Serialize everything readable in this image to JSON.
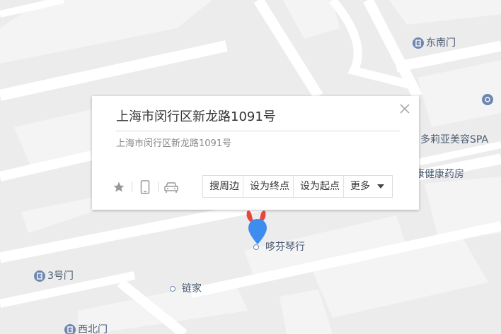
{
  "popup": {
    "title": "上海市闵行区新龙路1091号",
    "subtitle": "上海市闵行区新龙路1091号",
    "icons": [
      "star-icon",
      "phone-icon",
      "car-icon"
    ],
    "actions": {
      "search_nearby": "搜周边",
      "set_destination": "设为终点",
      "set_origin": "设为起点",
      "more": "更多"
    }
  },
  "pois": {
    "dongnanmen": "东南门",
    "duoliya": "多莉亚美容SPA",
    "pharmacy_partial": "康健康药房",
    "piano": "哆芬琴行",
    "gate3": "3号门",
    "lianjia": "链家",
    "xibeimen": "西北门"
  },
  "colors": {
    "map_background": "#ececec",
    "road": "#ffffff",
    "block": "#f4f4f4",
    "poi_icon": "#6f86b0",
    "poi_text": "#4a5a72",
    "marker_blue": "#3d8cf0",
    "marker_red": "#e8483a"
  }
}
